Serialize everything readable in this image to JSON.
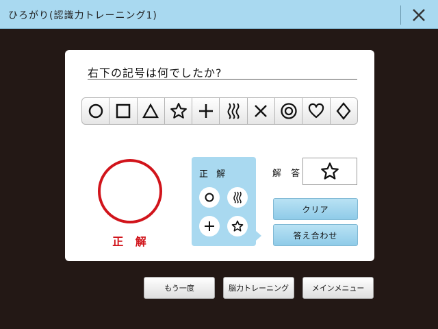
{
  "window": {
    "title": "ひろがり(認識力トレーニング1)",
    "close_icon": "close-icon"
  },
  "question": {
    "text": "右下の記号は何でしたか?"
  },
  "symbols": [
    {
      "name": "circle-icon"
    },
    {
      "name": "square-icon"
    },
    {
      "name": "triangle-icon"
    },
    {
      "name": "star-icon"
    },
    {
      "name": "plus-icon"
    },
    {
      "name": "wavy-lines-icon"
    },
    {
      "name": "cross-icon"
    },
    {
      "name": "double-circle-icon"
    },
    {
      "name": "heart-icon"
    },
    {
      "name": "diamond-icon"
    }
  ],
  "result": {
    "label": "正 解",
    "mark_icon": "red-circle-icon",
    "color": "#d1141b"
  },
  "correct_panel": {
    "label": "正 解",
    "items": [
      "circle-icon",
      "wavy-lines-icon",
      "plus-icon",
      "star-icon"
    ],
    "color": "#a9d9f0"
  },
  "answer": {
    "label": "解 答",
    "value_icon": "star-icon"
  },
  "buttons": {
    "clear": "クリア",
    "check": "答え合わせ",
    "retry": "もう一度",
    "brain_training": "脳力トレーニング",
    "main_menu": "メインメニュー"
  },
  "colors": {
    "background": "#231815",
    "accent": "#a9d9f0"
  }
}
